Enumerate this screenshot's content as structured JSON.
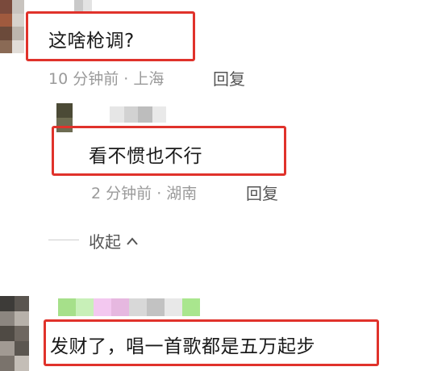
{
  "comments": [
    {
      "text": "这啥枪调?",
      "time": "10 分钟前",
      "separator": "·",
      "location": "上海",
      "reply_label": "回复",
      "avatar_colors": [
        "#7a4a3c",
        "#c9c4bf",
        "#a05a3e",
        "#d7d2cc",
        "#6b4a3a",
        "#bdb6ae",
        "#8a6a55",
        "#e2ddd8"
      ],
      "username_colors": [
        "#c9c9c9",
        "#e3e3e3"
      ]
    },
    {
      "text": "看不惯也不行",
      "time": "2 分钟前",
      "separator": "·",
      "location": "湖南",
      "reply_label": "回复",
      "avatar_colors": [
        "#4b4a36",
        "#6d6c52"
      ],
      "username_colors": [
        "#e6e6e6",
        "#d2d2d2",
        "#bdbdbd",
        "#e9e9e9"
      ]
    },
    {
      "text": "发财了，唱一首歌都是五万起步",
      "avatar_colors": [
        "#3d3b38",
        "#5a5550",
        "#8c8680",
        "#b7b1aa",
        "#4f4a44",
        "#6e6760",
        "#a19a93",
        "#5b5650",
        "#7a736c",
        "#c4beb7"
      ],
      "username_colors": [
        "#a6e08a",
        "#c8f0b8",
        "#f3c8f0",
        "#e6b8e0",
        "#d8d8d8",
        "#c2c2c2",
        "#e8e8e8",
        "#a9e68e"
      ]
    }
  ],
  "collapse_label": "收起",
  "highlight_color": "#e0322b"
}
